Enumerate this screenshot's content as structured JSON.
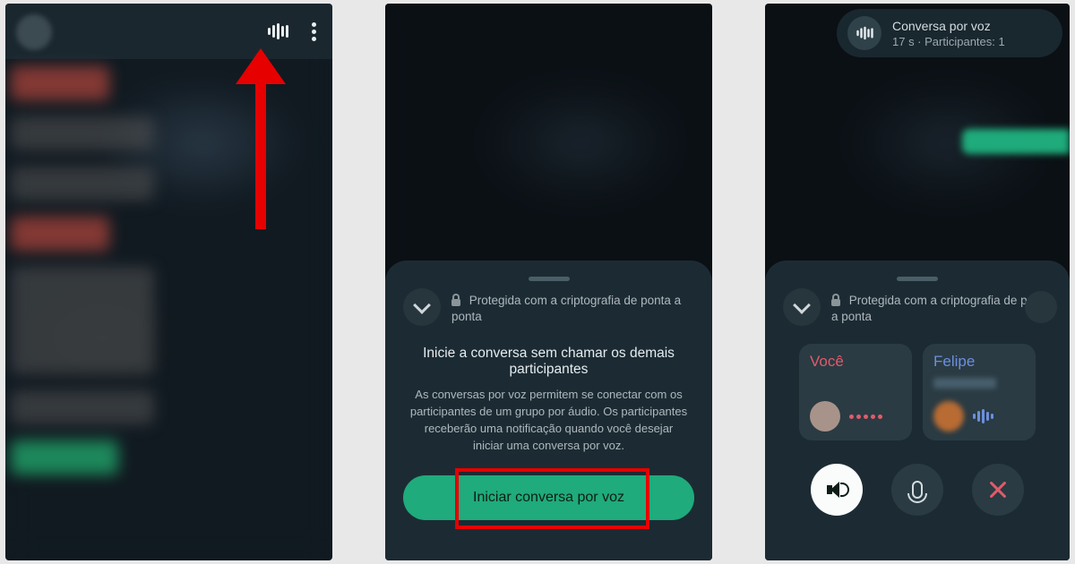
{
  "screen1": {
    "icon_label": "audio-waveform",
    "menu_label": "more-options"
  },
  "screen2": {
    "encryption_text": "Protegida com a criptografia de ponta a ponta",
    "headline": "Inicie a conversa sem chamar os demais participantes",
    "description": "As conversas por voz permitem se conectar com os participantes de um grupo por áudio. Os participantes receberão uma notificação quando você desejar iniciar uma conversa por voz.",
    "start_button": "Iniciar conversa por voz"
  },
  "screen3": {
    "chip_title": "Conversa por voz",
    "chip_subtitle": "17 s · Participantes: 1",
    "encryption_text": "Protegida com a criptografia de ponta a ponta",
    "participant1_name": "Você",
    "participant2_name": "Felipe",
    "speaker_label": "speaker",
    "mic_label": "microphone",
    "close_label": "close"
  }
}
